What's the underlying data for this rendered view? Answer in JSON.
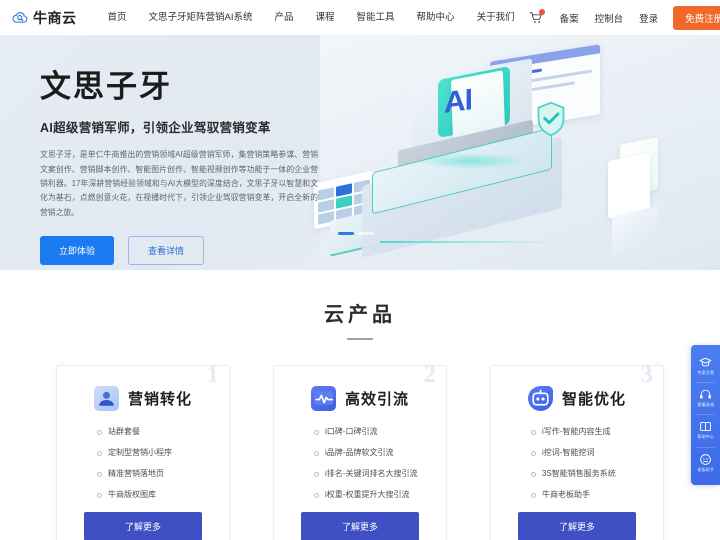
{
  "header": {
    "logo_text": "牛商云",
    "logo_icon": "cloud-search-icon",
    "nav": [
      {
        "label": "首页"
      },
      {
        "label": "文思子牙矩阵营销AI系统"
      },
      {
        "label": "产品"
      },
      {
        "label": "课程"
      },
      {
        "label": "智能工具"
      },
      {
        "label": "帮助中心"
      },
      {
        "label": "关于我们"
      }
    ],
    "cart_icon": "shopping-cart-icon",
    "links": [
      {
        "label": "备案"
      },
      {
        "label": "控制台"
      },
      {
        "label": "登录"
      }
    ],
    "register_label": "免费注册",
    "register_color": "#f1682a"
  },
  "hero": {
    "title": "文思子牙",
    "subtitle": "AI超级营销军师，引领企业驾驭营销变革",
    "description": "文思子牙，是单仁牛商推出的营销领域AI超级营销军师，集营销策略参谋、营销文案创作、营销脚本创作、智能图片创作、智能视频创作等功能于一体的企业营销利器。17年深耕营销经验领域和与AI大模型的深度结合，文思子牙以智慧和文化为基石，点燃创意火花，在视播时代下，引领企业驾驭营销变革，开启全新的营销之旅。",
    "primary_button": "立即体验",
    "ghost_button": "查看详情",
    "illustration_text": "AI",
    "carousel": {
      "total": 2,
      "active": 1
    },
    "bg_color": "#e3eaf2",
    "accent_color": "#1a7aef"
  },
  "products": {
    "section_title": "云产品",
    "cards": [
      {
        "number": "1",
        "icon": "user-monitor-icon",
        "title": "营销转化",
        "items": [
          "站群套餐",
          "定制型营销小程序",
          "精准营销落地页",
          "牛商版权图库"
        ],
        "button": "了解更多"
      },
      {
        "number": "2",
        "icon": "traffic-pulse-icon",
        "title": "高效引流",
        "items": [
          "i口碑-口碑引流",
          "i品牌-品牌软文引流",
          "i排名-关键词排名大搜引流",
          "i权重-权重提升大搜引流"
        ],
        "button": "了解更多"
      },
      {
        "number": "3",
        "icon": "robot-ai-icon",
        "title": "智能优化",
        "items": [
          "i写作-智能内容生成",
          "i挖词-智能挖词",
          "3S智能销售服务系统",
          "牛商老板助手"
        ],
        "button": "了解更多"
      }
    ],
    "button_color": "#3f4fc4"
  },
  "floating_sidebar": {
    "bg_color": "#4a7ef0",
    "items": [
      {
        "icon": "graduation-cap-icon",
        "label": "专家方案"
      },
      {
        "icon": "headset-icon",
        "label": "客服咨询"
      },
      {
        "icon": "book-icon",
        "label": "帮助中心"
      },
      {
        "icon": "robot-face-icon",
        "label": "老板助手"
      }
    ]
  }
}
